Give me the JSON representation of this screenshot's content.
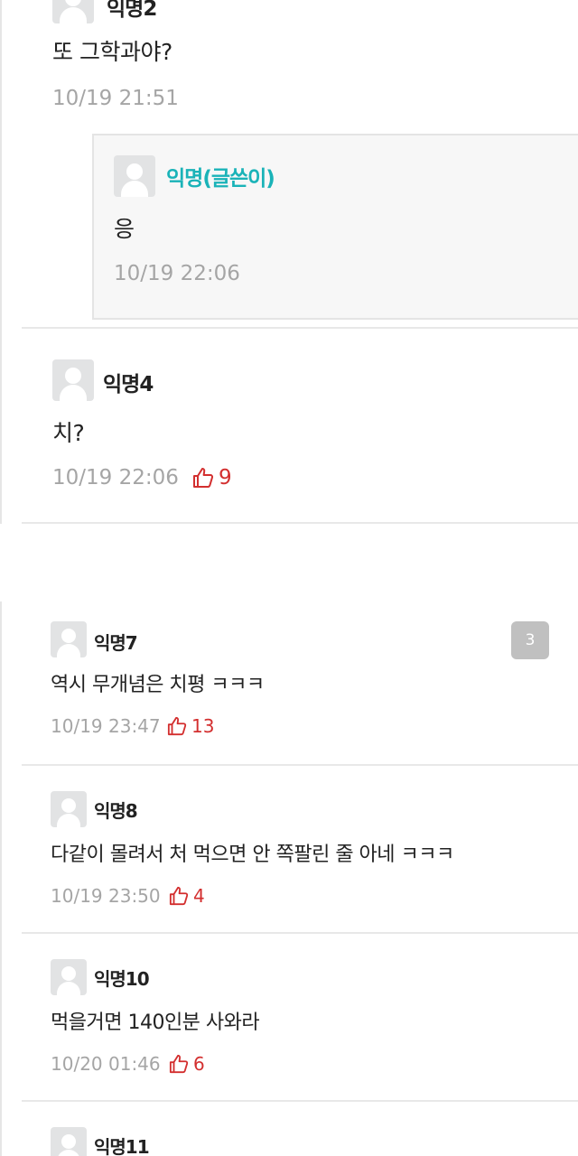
{
  "comments_top": [
    {
      "nickname": "익명2",
      "text": "또 그학과야?",
      "time": "10/19 21:51",
      "reply": {
        "nickname": "익명(글쓴이)",
        "text": "응",
        "time": "10/19 22:06"
      }
    },
    {
      "nickname": "익명4",
      "text": "치?",
      "time": "10/19 22:06",
      "likes": "9"
    }
  ],
  "comments_bottom": [
    {
      "nickname": "익명7",
      "text": "역시 무개념은 치평 ㅋㅋㅋ",
      "time": "10/19 23:47",
      "likes": "13"
    },
    {
      "nickname": "익명8",
      "text": "다같이 몰려서 처 먹으면 안 쪽팔린 줄 아네 ㅋㅋㅋ",
      "time": "10/19 23:50",
      "likes": "4"
    },
    {
      "nickname": "익명10",
      "text": "먹을거면 140인분 사와라",
      "time": "10/20 01:46",
      "likes": "6"
    },
    {
      "nickname": "익명11"
    }
  ],
  "vote_badge": "3",
  "colors": {
    "like": "#d32f2f",
    "writer": "#1ab3b8",
    "meta": "#a5a5a5"
  }
}
